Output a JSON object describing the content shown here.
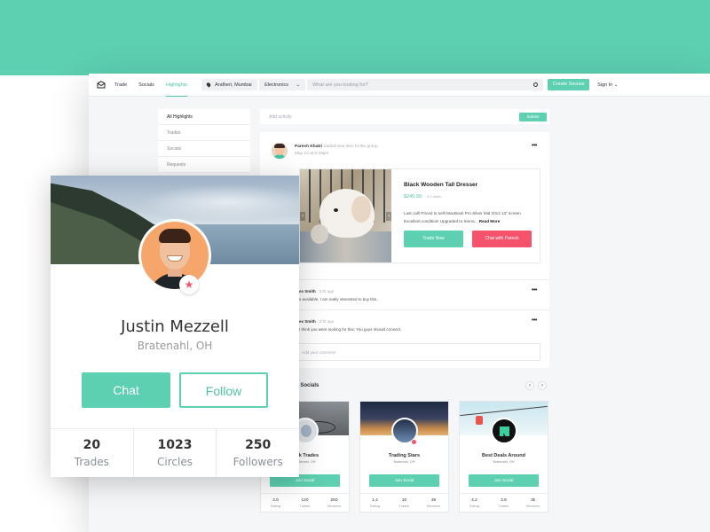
{
  "colors": {
    "accent": "#5dd0b1",
    "danger": "#f4536b"
  },
  "nav": {
    "links": [
      "Trade",
      "Socials",
      "Highlights"
    ],
    "location": "Andheri, Mumbai",
    "category": "Electronics",
    "search_placeholder": "What are you looking for?",
    "create_label": "Create Socials",
    "signin_label": "Sign In"
  },
  "sidebar": {
    "items": [
      "All Highlights",
      "Trades",
      "Socials",
      "Requests"
    ]
  },
  "activity": {
    "placeholder": "Add activity",
    "submit_label": "Submit"
  },
  "post": {
    "author": "Paresh Khatri",
    "action": "traded new item to the group.",
    "time": "May 23 at 6:18pm",
    "more_icon": "more-dots-icon",
    "item": {
      "title": "Black Wooden Tall Dresser",
      "price": "$245.00",
      "price_ago": "3.2 miles",
      "desc": "Last call! Priced to sell! MacBook Pro Silver Mid 2012 13\" screen Excellent condition! Upgraded to Sierra...",
      "more": "Read More",
      "trade_label": "Trade Now",
      "chat_label": "Chat with Paresh"
    },
    "comments": [
      {
        "who": "es Smith",
        "time": "2 hr ago",
        "text": "s available. I am really interested to buy this.."
      },
      {
        "who": "es Smith",
        "time": "2 hr ago",
        "text": "I think you were looking for this. You guys should connect."
      }
    ],
    "comment_placeholder": "Add your comment"
  },
  "socials": {
    "title": "l Socials",
    "cards": [
      {
        "name": "York Trades",
        "loc": "Bratenahl, OH",
        "join": "Join Social",
        "rating": "3.0",
        "trades": "120",
        "members": "250"
      },
      {
        "name": "Trading Stars",
        "loc": "Bratenahl, OH",
        "join": "Join Social",
        "rating": "1.4",
        "trades": "10",
        "members": "39"
      },
      {
        "name": "Best Deals Around",
        "loc": "Bratenahl, OH",
        "join": "Join Social",
        "rating": "4.2",
        "trades": "3.6",
        "members": "3k"
      }
    ],
    "stat_labels": [
      "Rating",
      "Trades",
      "Members"
    ]
  },
  "profile": {
    "name": "Justin Mezzell",
    "location": "Bratenahl, OH",
    "chat_label": "Chat",
    "follow_label": "Follow",
    "stats": [
      {
        "value": "20",
        "label": "Trades"
      },
      {
        "value": "1023",
        "label": "Circles"
      },
      {
        "value": "250",
        "label": "Followers"
      }
    ]
  }
}
